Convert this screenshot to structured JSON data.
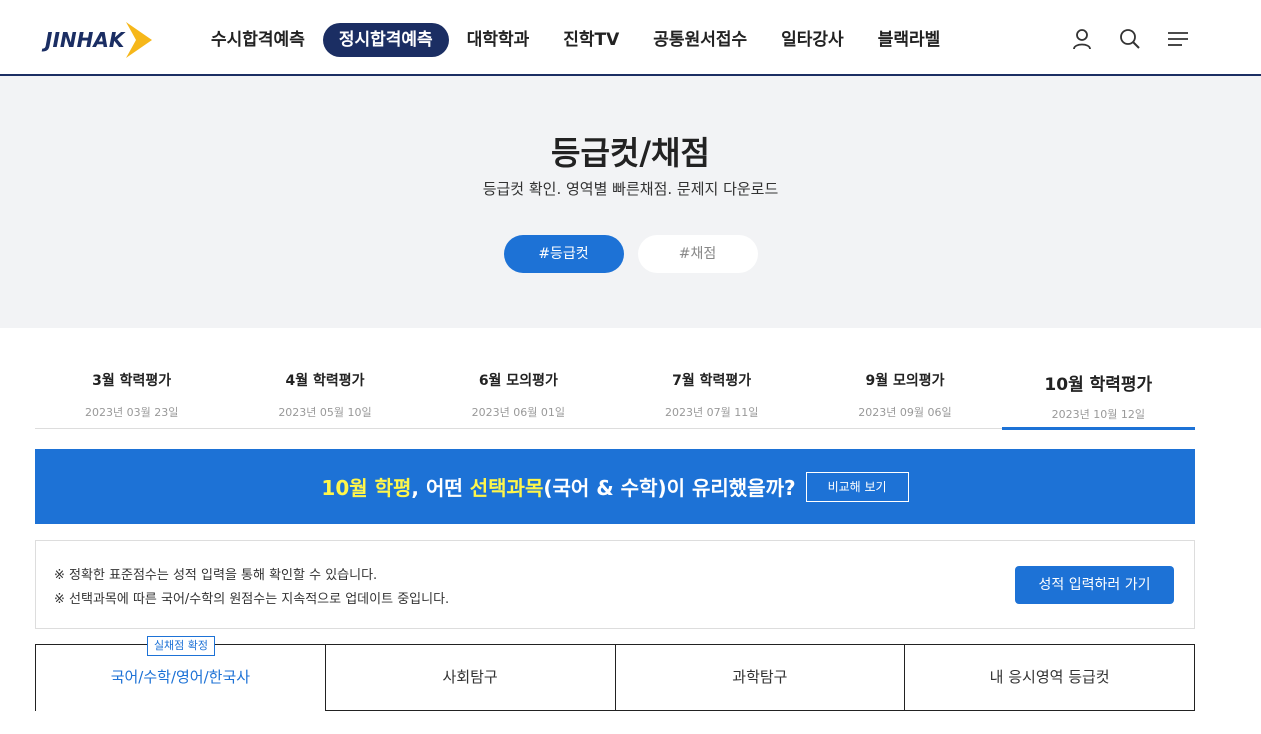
{
  "header": {
    "logo_text": "JINHAK",
    "nav": [
      "수시합격예측",
      "정시합격예측",
      "대학학과",
      "진학TV",
      "공통원서접수",
      "일타강사",
      "블랙라벨"
    ],
    "active_nav_index": 1,
    "icons": [
      "user-icon",
      "search-icon",
      "menu-icon"
    ],
    "brand_color": "#1b2e63",
    "accent_arrow_color": "#f6b71a"
  },
  "hero": {
    "title": "등급컷/채점",
    "subtitle": "등급컷 확인. 영역별 빠른채점. 문제지 다운로드",
    "tags": [
      "#등급컷",
      "#채점"
    ]
  },
  "exams": [
    {
      "name": "3월 학력평가",
      "date": "2023년 03월 23일"
    },
    {
      "name": "4월 학력평가",
      "date": "2023년 05월 10일"
    },
    {
      "name": "6월 모의평가",
      "date": "2023년 06월 01일"
    },
    {
      "name": "7월 학력평가",
      "date": "2023년 07월 11일"
    },
    {
      "name": "9월 모의평가",
      "date": "2023년 09월 06일"
    },
    {
      "name": "10월 학력평가",
      "date": "2023년 10월 12일"
    }
  ],
  "banner": {
    "part1": "10월 학평",
    "part2": ", 어떤 ",
    "part3": "선택과목",
    "part4": "(국어 & 수학)이 유리했을까?",
    "button": "비교해 보기",
    "background": "#1d72d6",
    "highlight": "#fff64a"
  },
  "notice": {
    "lines": [
      "※ 정확한 표준점수는 성적 입력을 통해 확인할 수 있습니다.",
      "※ 선택과목에 따른 국어/수학의 원점수는 지속적으로 업데이트 중입니다."
    ],
    "button": "성적 입력하러 가기"
  },
  "subjects": {
    "badge": "실채점 확정",
    "tabs": [
      "국어/수학/영어/한국사",
      "사회탐구",
      "과학탐구",
      "내 응시영역 등급컷"
    ]
  }
}
